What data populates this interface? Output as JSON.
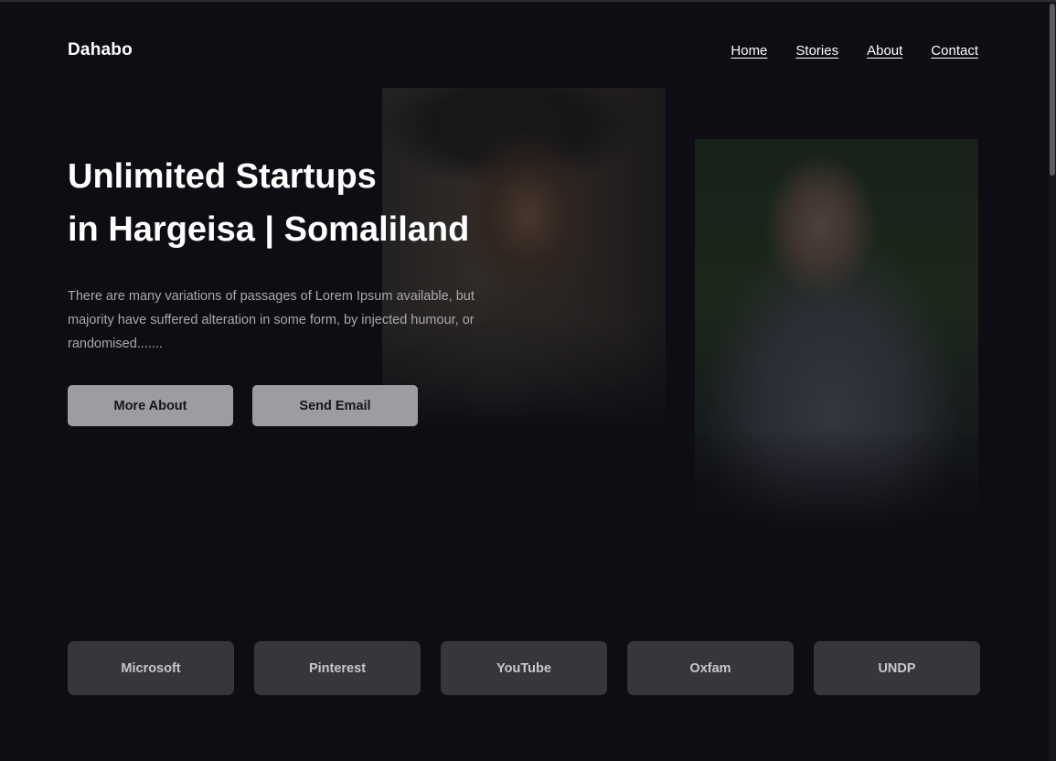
{
  "brand": {
    "name": "Dahabo"
  },
  "nav": {
    "items": [
      {
        "label": "Home"
      },
      {
        "label": "Stories"
      },
      {
        "label": "About"
      },
      {
        "label": "Contact"
      }
    ]
  },
  "hero": {
    "title_line1": "Unlimited Startups",
    "title_line2": "in Hargeisa | Somaliland",
    "description": "There are many variations of passages of Lorem Ipsum available, but majority have suffered alteration in some form, by injected humour, or randomised.......",
    "buttons": {
      "more_about": "More About",
      "send_email": "Send Email"
    }
  },
  "partners": [
    {
      "label": "Microsoft"
    },
    {
      "label": "Pinterest"
    },
    {
      "label": "YouTube"
    },
    {
      "label": "Oxfam"
    },
    {
      "label": "UNDP"
    }
  ],
  "colors": {
    "background": "#0e0d13",
    "button": "#9d9ca1",
    "partner_card": "#37363d",
    "text_primary": "#ffffff",
    "text_muted": "#a9a8ad"
  }
}
